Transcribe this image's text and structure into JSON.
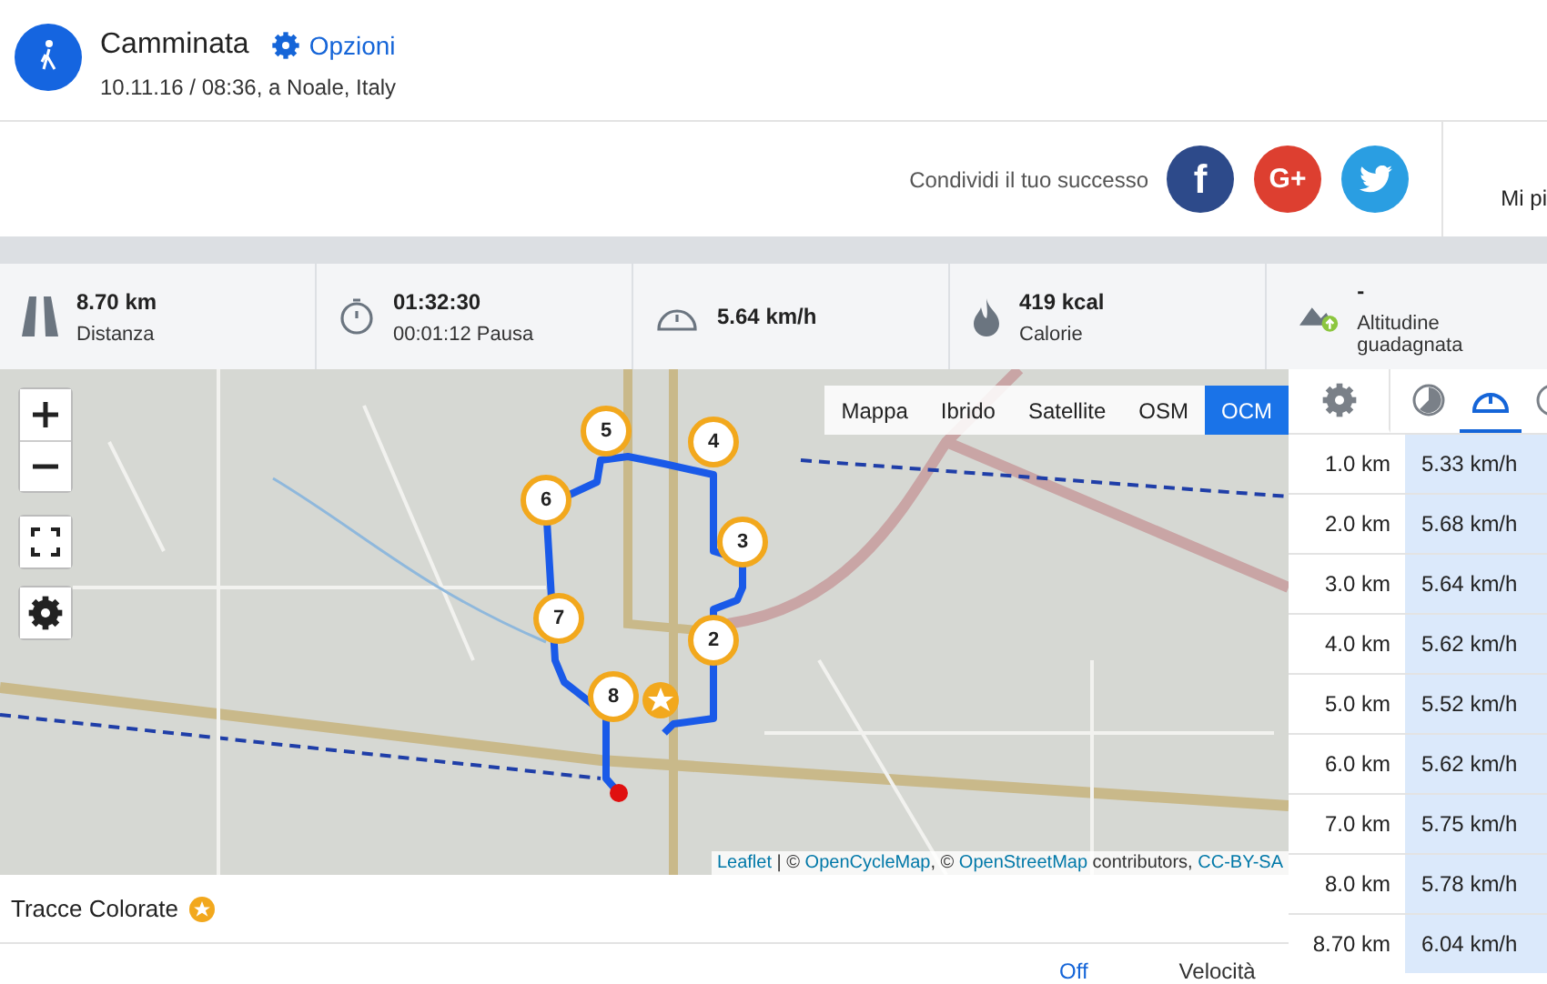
{
  "activity": {
    "title": "Camminata",
    "options_link": "Opzioni",
    "subtitle": "10.11.16 / 08:36, a Noale, Italy"
  },
  "share": {
    "label": "Condividi il tuo successo",
    "buttons": [
      {
        "kind": "facebook",
        "text": "f"
      },
      {
        "kind": "googleplus",
        "text": "G+"
      },
      {
        "kind": "twitter"
      }
    ],
    "side_text": "Mi pi"
  },
  "stats": [
    {
      "kind": "road",
      "value": "8.70 km",
      "label": "Distanza"
    },
    {
      "kind": "timer",
      "value": "01:32:30",
      "label": "00:01:12 Pausa"
    },
    {
      "kind": "speed",
      "value": "5.64 km/h"
    },
    {
      "kind": "flame",
      "value": "419 kcal",
      "label": "Calorie"
    },
    {
      "kind": "altitude",
      "value": "-",
      "label": "Altitudine guadagnata"
    }
  ],
  "map": {
    "layers": [
      {
        "label": "Mappa",
        "selected": false
      },
      {
        "label": "Ibrido",
        "selected": false
      },
      {
        "label": "Satellite",
        "selected": false
      },
      {
        "label": "OSM",
        "selected": false
      },
      {
        "label": "OCM",
        "selected": true
      }
    ],
    "markers": [
      "5",
      "4",
      "3",
      "2",
      "6",
      "7",
      "8"
    ],
    "attribution": [
      {
        "kind": "link",
        "text": "Leaflet"
      },
      {
        "kind": "text",
        "text": " | © "
      },
      {
        "kind": "link",
        "text": "OpenCycleMap"
      },
      {
        "kind": "text",
        "text": ", © "
      },
      {
        "kind": "link",
        "text": "OpenStreetMap"
      },
      {
        "kind": "text",
        "text": " contributors, "
      },
      {
        "kind": "link",
        "text": "CC-BY-SA"
      }
    ]
  },
  "colored_tracks": {
    "label": "Tracce Colorate"
  },
  "footer": {
    "toggle": "Off",
    "metric": "Velocità"
  },
  "splits": {
    "tabs": [
      {
        "kind": "settings",
        "selected": false
      },
      {
        "kind": "pie",
        "selected": false
      },
      {
        "kind": "speed",
        "selected": true
      },
      {
        "kind": "clock",
        "selected": false
      }
    ],
    "rows": [
      {
        "distance": "1.0 km",
        "speed": "5.33 km/h"
      },
      {
        "distance": "2.0 km",
        "speed": "5.68 km/h"
      },
      {
        "distance": "3.0 km",
        "speed": "5.64 km/h"
      },
      {
        "distance": "4.0 km",
        "speed": "5.62 km/h"
      },
      {
        "distance": "5.0 km",
        "speed": "5.52 km/h"
      },
      {
        "distance": "6.0 km",
        "speed": "5.62 km/h"
      },
      {
        "distance": "7.0 km",
        "speed": "5.75 km/h"
      },
      {
        "distance": "8.0 km",
        "speed": "5.78 km/h"
      },
      {
        "distance": "8.70 km",
        "speed": "6.04 km/h"
      }
    ]
  }
}
